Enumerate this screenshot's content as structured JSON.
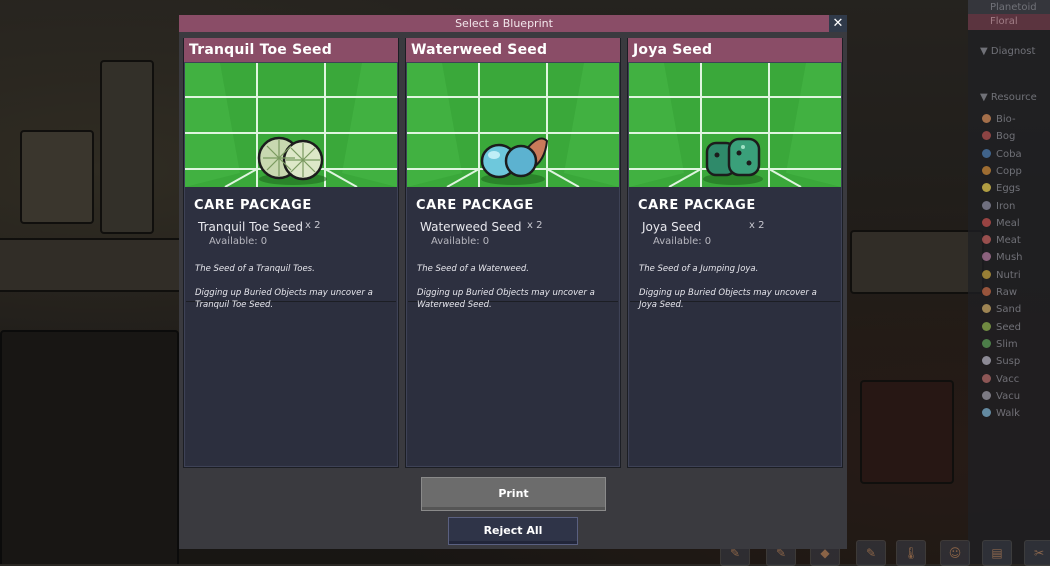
{
  "dialog": {
    "title": "Select a Blueprint",
    "close_glyph": "✕",
    "print_label": "Print",
    "reject_label": "Reject All"
  },
  "cards": [
    {
      "header": "Tranquil Toe Seed",
      "package_label": "CARE PACKAGE",
      "item_name": "Tranquil Toe Seed",
      "quantity": "x 2",
      "available": "Available: 0",
      "desc1": "The Seed of a Tranquil Toes.",
      "desc2": "Digging up Buried Objects may uncover a Tranquil Toe Seed.",
      "icon": "tranquil-toe-seed-icon"
    },
    {
      "header": "Waterweed Seed",
      "package_label": "CARE PACKAGE",
      "item_name": "Waterweed Seed",
      "quantity": "x 2",
      "available": "Available: 0",
      "desc1": "The Seed of a Waterweed.",
      "desc2": "Digging up Buried Objects may uncover a Waterweed Seed.",
      "icon": "waterweed-seed-icon"
    },
    {
      "header": "Joya Seed",
      "package_label": "CARE PACKAGE",
      "item_name": "Joya Seed",
      "quantity": "x 2",
      "available": "Available: 0",
      "desc1": "The Seed of a Jumping Joya.",
      "desc2": "Digging up Buried Objects may uncover a Joya Seed.",
      "icon": "joya-seed-icon"
    }
  ],
  "side_panel": {
    "header": "Planetoid",
    "filter": "Floral",
    "diagnostics": "Diagnost",
    "resources": "Resource",
    "items": [
      "Bio-",
      "Bog",
      "Coba",
      "Copp",
      "Eggs",
      "Iron",
      "Meal",
      "Meat",
      "Mush",
      "Nutri",
      "Raw",
      "Sand",
      "Seed",
      "Slim",
      "Susp",
      "Vacc",
      "Vacu",
      "Walk"
    ]
  },
  "colors": {
    "accent": "#8a4d67",
    "grid_green": "#3aa83a",
    "card_bg": "#2d3040"
  }
}
